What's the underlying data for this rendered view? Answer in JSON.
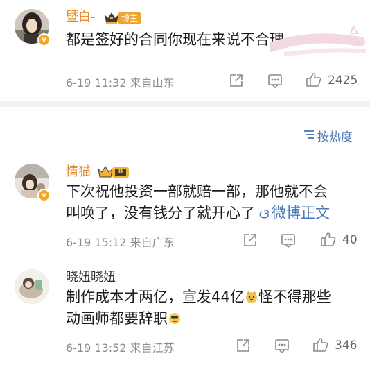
{
  "colors": {
    "accent_orange": "#e8872b",
    "link_blue": "#4a7ab8",
    "meta_gray": "#8b8b8b",
    "separator": "#f2f2f2"
  },
  "top_post": {
    "username": "暨白-",
    "badge": "博主",
    "content": "都是签好的合同你现在来说不合理",
    "meta": "6-19 11:32 来自山东",
    "like_count": "2425",
    "icons": [
      "share-icon",
      "comment-icon",
      "like-icon"
    ]
  },
  "sort": {
    "label": "按热度",
    "icon": "sort-icon"
  },
  "comments": [
    {
      "username": "情猫",
      "level_badge": "Ⅱ",
      "content_line1": "下次祝他投资一部就赔一部，那他就不会",
      "content_line2": "叫唤了，没有钱分了就开心了",
      "link_text": "微博正文",
      "meta": "6-19 15:12 来自广东",
      "like_count": "40"
    },
    {
      "username": "晓妞晓妞",
      "content_line1_a": "制作成本才两亿，宣发44亿",
      "content_line1_b": "怪不得那些",
      "content_line2": "动画师都要辞职",
      "meta": "6-19 13:52 来自江苏",
      "like_count": "346"
    }
  ]
}
